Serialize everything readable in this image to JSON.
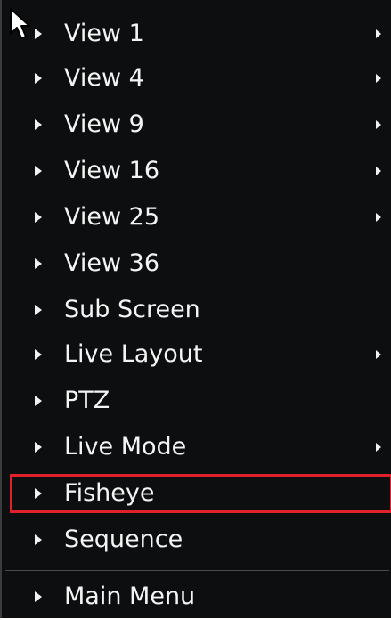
{
  "menu": {
    "items": [
      {
        "label": "View 1",
        "has_submenu": true
      },
      {
        "label": "View 4",
        "has_submenu": true
      },
      {
        "label": "View 9",
        "has_submenu": true
      },
      {
        "label": "View 16",
        "has_submenu": true
      },
      {
        "label": "View 25",
        "has_submenu": true
      },
      {
        "label": "View 36",
        "has_submenu": false
      },
      {
        "label": "Sub Screen",
        "has_submenu": false
      },
      {
        "label": "Live Layout",
        "has_submenu": true
      },
      {
        "label": "PTZ",
        "has_submenu": false
      },
      {
        "label": "Live Mode",
        "has_submenu": true
      },
      {
        "label": "Fisheye",
        "has_submenu": false,
        "highlighted": true
      },
      {
        "label": "Sequence",
        "has_submenu": false
      },
      {
        "label": "Main Menu",
        "has_submenu": false
      }
    ]
  },
  "colors": {
    "background": "#0d0e0f",
    "text": "#f4f4f4",
    "highlight_border": "#e0202a"
  },
  "icons": {
    "bullet": "bullet-triangle-icon",
    "submenu": "chevron-right-icon",
    "cursor": "mouse-pointer-icon"
  }
}
